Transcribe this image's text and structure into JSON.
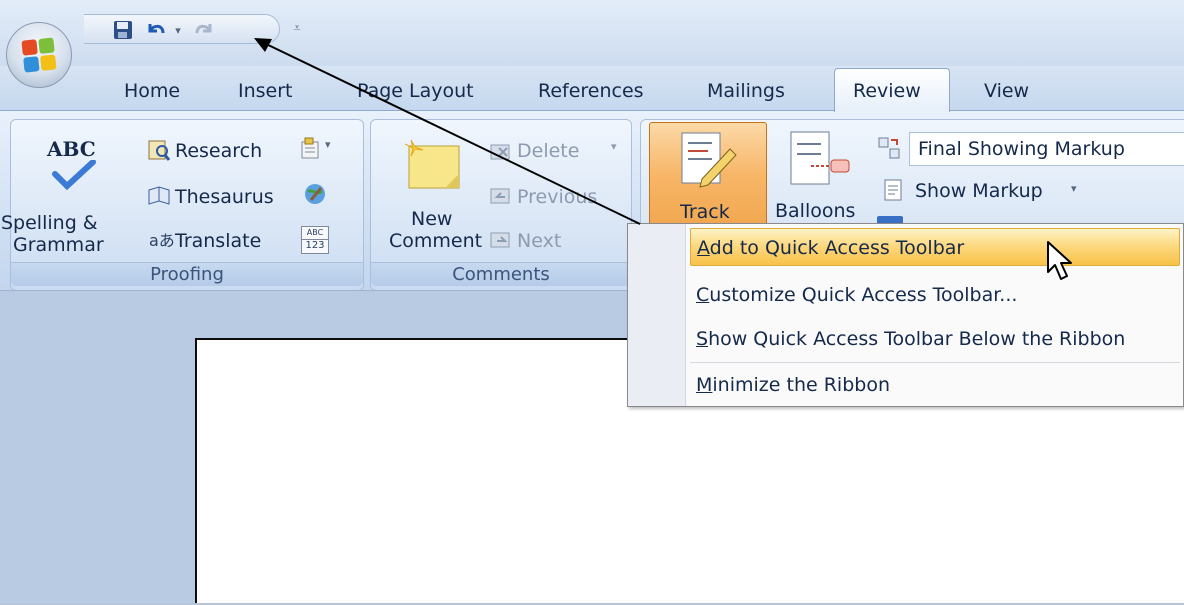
{
  "quick_access": {
    "save_icon": "save-icon",
    "undo_icon": "undo-icon",
    "redo_icon": "redo-icon",
    "customize_icon": "customize-qat-icon"
  },
  "tabs": [
    {
      "label": "Home"
    },
    {
      "label": "Insert"
    },
    {
      "label": "Page Layout"
    },
    {
      "label": "References"
    },
    {
      "label": "Mailings"
    },
    {
      "label": "Review",
      "active": true
    },
    {
      "label": "View"
    }
  ],
  "ribbon": {
    "proofing": {
      "group_label": "Proofing",
      "spelling_icon_text": "ABC",
      "spelling_label_line1": "Spelling &",
      "spelling_label_line2": "Grammar",
      "research": "Research",
      "thesaurus": "Thesaurus",
      "translate": "Translate",
      "word_count_icon_text_1": "ABC",
      "word_count_icon_text_2": "123"
    },
    "comments": {
      "group_label": "Comments",
      "new_label_line1": "New",
      "new_label_line2": "Comment",
      "delete": "Delete",
      "previous": "Previous",
      "next": "Next"
    },
    "tracking": {
      "track_label": "Track",
      "balloons_label": "Balloons",
      "display_for_review": "Final Showing Markup",
      "show_markup": "Show Markup"
    }
  },
  "context_menu": {
    "items": [
      {
        "label": "Add to Quick Access Toolbar",
        "accel": "A",
        "highlighted": true
      },
      {
        "label": "Customize Quick Access Toolbar...",
        "accel": "C"
      },
      {
        "label": "Show Quick Access Toolbar Below the Ribbon",
        "accel": "S"
      },
      {
        "label": "Minimize the Ribbon",
        "accel": "M"
      }
    ]
  },
  "colors": {
    "ribbon_blue": "#cddcef",
    "menu_highlight": "#fcd77b",
    "track_active": "#f0a34a"
  }
}
